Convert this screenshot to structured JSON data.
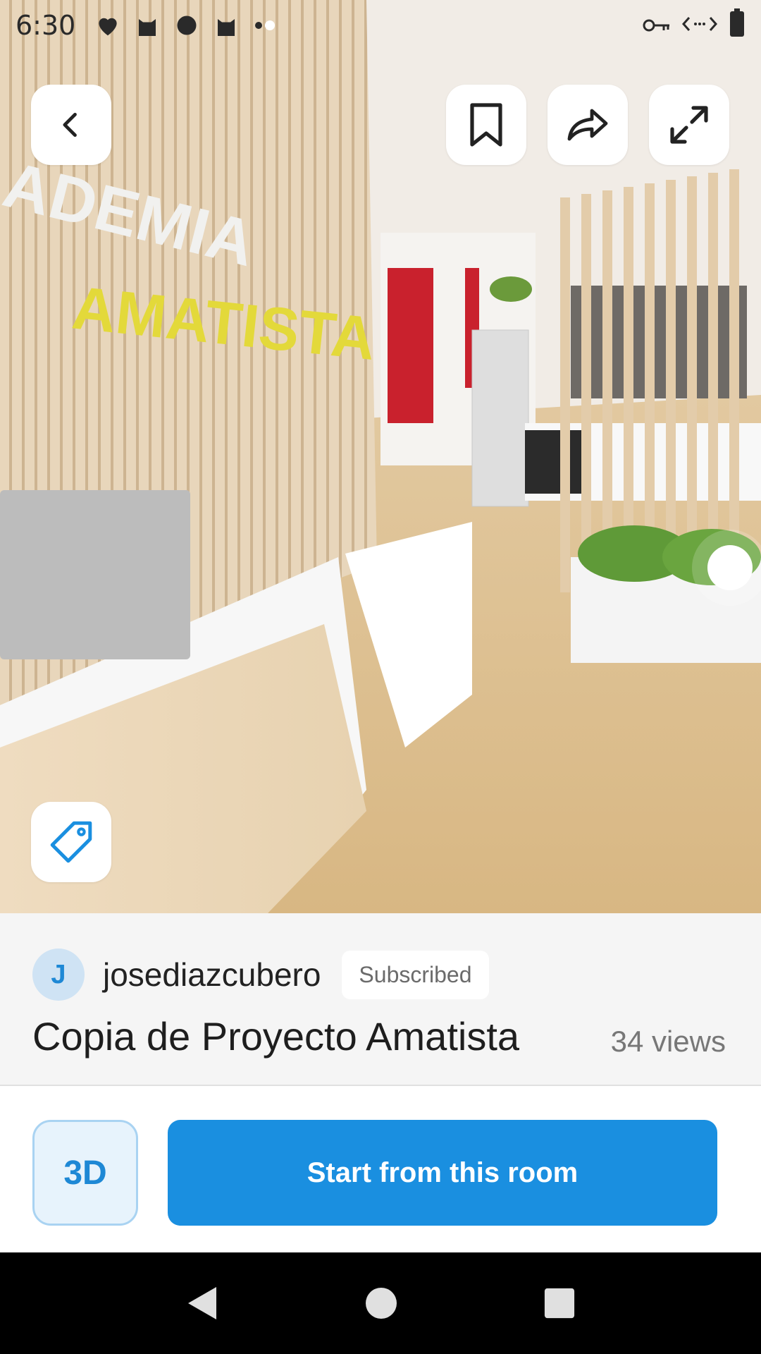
{
  "status_bar": {
    "time": "6:30",
    "left_icons": [
      "heart-pulse-icon",
      "cat-icon",
      "leaf-badge-icon",
      "cat-icon"
    ],
    "right_icons": [
      "key-icon",
      "code-arrows-icon",
      "battery-icon"
    ]
  },
  "overlay": {
    "back": "chevron-left-icon",
    "bookmark": "bookmark-icon",
    "share": "share-arrow-icon",
    "fullscreen": "expand-icon",
    "tag": "tag-icon"
  },
  "scene": {
    "sign_top": "ADEMIA",
    "sign_brand": "AMATISTA"
  },
  "info": {
    "avatar_letter": "J",
    "author": "josediazcubero",
    "subscribed": "Subscribed",
    "title": "Copia de Proyecto Amatista",
    "views": "34 views"
  },
  "actions": {
    "mode_3d": "3D",
    "start": "Start from this room"
  },
  "colors": {
    "primary": "#1a8fe0",
    "primary_light": "#e7f3fc",
    "avatar_bg": "#cfe3f4"
  }
}
